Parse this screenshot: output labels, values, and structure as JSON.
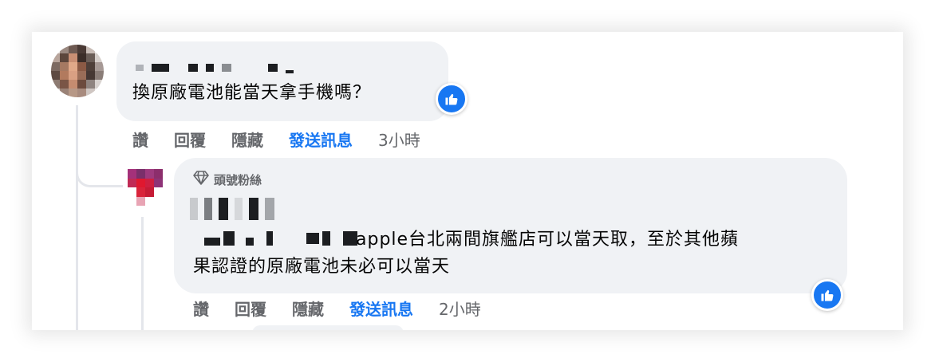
{
  "comment1": {
    "text": "換原廠電池能當天拿手機嗎？",
    "reaction_icon": "like-icon",
    "actions": {
      "like": "讚",
      "reply": "回覆",
      "hide": "隱藏",
      "send": "發送訊息",
      "time": "3小時"
    }
  },
  "comment2": {
    "badge": {
      "icon": "diamond-icon",
      "label": "頭號粉絲"
    },
    "text_line1": "apple台北兩間旗艦店可以當天取，至於其他蘋",
    "text_line2": "果認證的原廠電池未必可以當天",
    "reaction_icon": "like-icon",
    "actions": {
      "like": "讚",
      "reply": "回覆",
      "hide": "隱藏",
      "send": "發送訊息",
      "time": "2小時"
    }
  },
  "colors": {
    "bubble": "#f0f2f5",
    "link_blue": "#1877f2",
    "secondary_text": "#65676b",
    "primary_text": "#050505"
  }
}
